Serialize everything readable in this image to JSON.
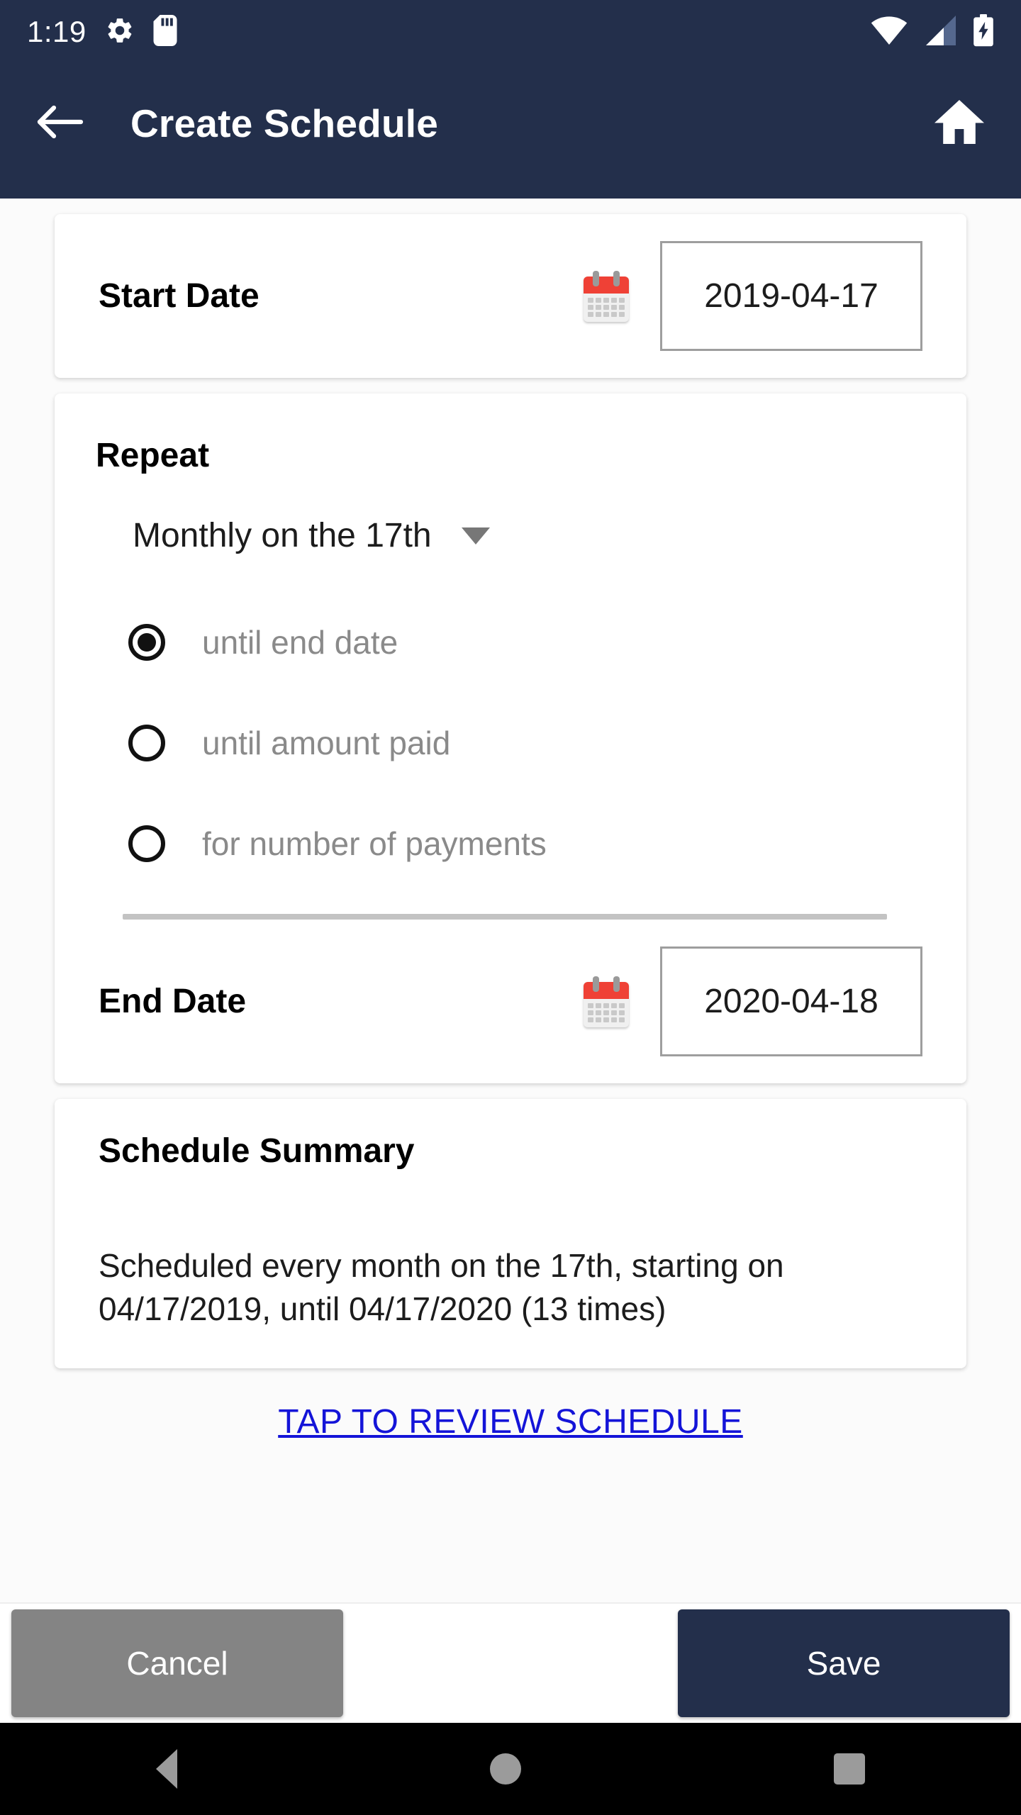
{
  "status_bar": {
    "clock": "1:19",
    "left_icons": [
      "gear-icon",
      "sd-card-icon"
    ],
    "right_icons": [
      "wifi-icon",
      "cellular-signal-icon",
      "battery-charging-icon"
    ],
    "background_color": "#232f4b"
  },
  "app_bar": {
    "back_icon": "arrow-left-icon",
    "title": "Create Schedule",
    "home_icon": "home-icon",
    "background_color": "#232f4b"
  },
  "start_date": {
    "label": "Start Date",
    "calendar_icon": "calendar-icon",
    "value": "2019-04-17"
  },
  "repeat": {
    "title": "Repeat",
    "frequency_value": "Monthly on the 17th",
    "dropdown_icon": "chevron-down-icon",
    "options": [
      {
        "label": "until end date",
        "selected": true
      },
      {
        "label": "until amount paid",
        "selected": false
      },
      {
        "label": "for number of payments",
        "selected": false
      }
    ]
  },
  "end_date": {
    "label": "End Date",
    "calendar_icon": "calendar-icon",
    "value": "2020-04-18"
  },
  "summary": {
    "title": "Schedule Summary",
    "text": "Scheduled every month on the 17th, starting on 04/17/2019, until 04/17/2020 (13 times)"
  },
  "review_link": {
    "label": "TAP TO REVIEW SCHEDULE",
    "color": "#1414d8"
  },
  "actions": {
    "cancel_label": "Cancel",
    "cancel_color": "#848484",
    "save_label": "Save",
    "save_color": "#232f4b"
  },
  "nav_bar": {
    "back_icon": "triangle-back-icon",
    "home_icon": "circle-home-icon",
    "recents_icon": "square-recents-icon"
  }
}
